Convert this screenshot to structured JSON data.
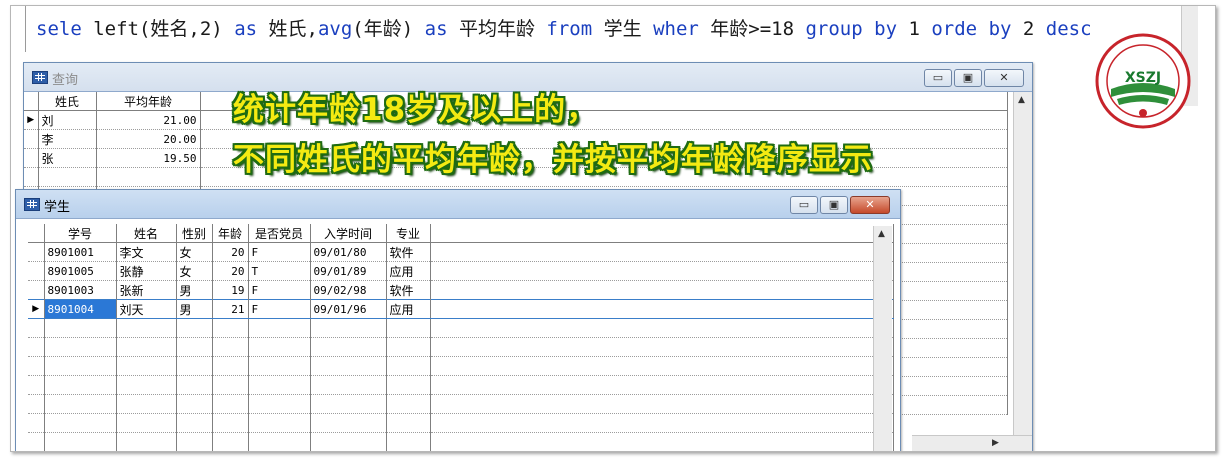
{
  "command": {
    "t1": "sele",
    "t2": " left(",
    "t3": "姓名",
    "t4": ",2) ",
    "t5": "as",
    "t6": " 姓氏,",
    "t7": "avg",
    "t8": "(年龄) ",
    "t9": "as",
    "t10": " 平均年龄 ",
    "t11": "from",
    "t12": " 学生 ",
    "t13": "wher",
    "t14": " 年龄>=18 ",
    "t15": "group",
    "t16": " ",
    "t17": "by",
    "t18": " 1 ",
    "t19": "orde",
    "t20": " ",
    "t21": "by",
    "t22": " 2 ",
    "t23": "desc"
  },
  "query_window": {
    "title": "查询",
    "columns": [
      "姓氏",
      "平均年龄"
    ],
    "rows": [
      {
        "surname": "刘",
        "avg_age": "21.00"
      },
      {
        "surname": "李",
        "avg_age": "20.00"
      },
      {
        "surname": "张",
        "avg_age": "19.50"
      }
    ]
  },
  "student_window": {
    "title": "学生",
    "columns": [
      "学号",
      "姓名",
      "性别",
      "年龄",
      "是否党员",
      "入学时间",
      "专业"
    ],
    "rows": [
      {
        "id": "8901001",
        "name": "李文",
        "gender": "女",
        "age": "20",
        "party": "F",
        "date": "09/01/80",
        "major": "软件"
      },
      {
        "id": "8901005",
        "name": "张静",
        "gender": "女",
        "age": "20",
        "party": "T",
        "date": "09/01/89",
        "major": "应用"
      },
      {
        "id": "8901003",
        "name": "张新",
        "gender": "男",
        "age": "19",
        "party": "F",
        "date": "09/02/98",
        "major": "软件"
      },
      {
        "id": "8901004",
        "name": "刘天",
        "gender": "男",
        "age": "21",
        "party": "F",
        "date": "09/01/96",
        "major": "应用"
      }
    ]
  },
  "window_buttons": {
    "minimize": "▭",
    "maximize": "▣",
    "close": "✕"
  },
  "overlay": {
    "line1": "统计年龄18岁及以上的，",
    "line2": "不同姓氏的平均年龄，并按平均年龄降序显示"
  },
  "logo": {
    "letters": "XSZJ"
  },
  "colors": {
    "keyword": "#1a3fbf",
    "overlay_text": "#f4ea12",
    "overlay_outline": "#1f6b12",
    "selection": "#2b78d6"
  }
}
